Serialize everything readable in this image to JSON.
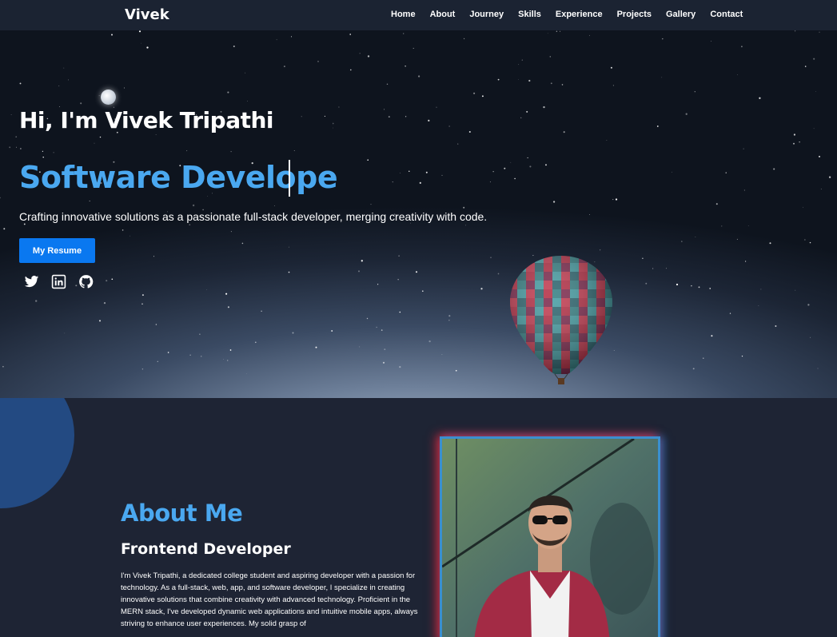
{
  "nav": {
    "brand": "Vivek",
    "links": [
      "Home",
      "About",
      "Journey",
      "Skills",
      "Experience",
      "Projects",
      "Gallery",
      "Contact"
    ]
  },
  "hero": {
    "title": "Hi, I'm Vivek Tripathi",
    "role": "Software Develope",
    "tagline": "Crafting innovative solutions as a passionate full-stack developer, merging creativity with code.",
    "resume_button": "My Resume",
    "socials": [
      "twitter-icon",
      "linkedin-icon",
      "github-icon"
    ]
  },
  "about": {
    "heading": "About Me",
    "subheading": "Frontend Developer",
    "body": "I'm Vivek Tripathi, a dedicated college student and aspiring developer with a passion for technology. As a full-stack, web, app, and software developer, I specialize in creating innovative solutions that combine creativity with advanced technology. Proficient in the MERN stack, I've developed dynamic web applications and intuitive mobile apps, always striving to enhance user experiences. My solid grasp of"
  },
  "colors": {
    "accent": "#4aa8f0",
    "button": "#0a78f0",
    "navbar": "#1b2332",
    "background": "#1e2434",
    "blob": "#234a82"
  }
}
